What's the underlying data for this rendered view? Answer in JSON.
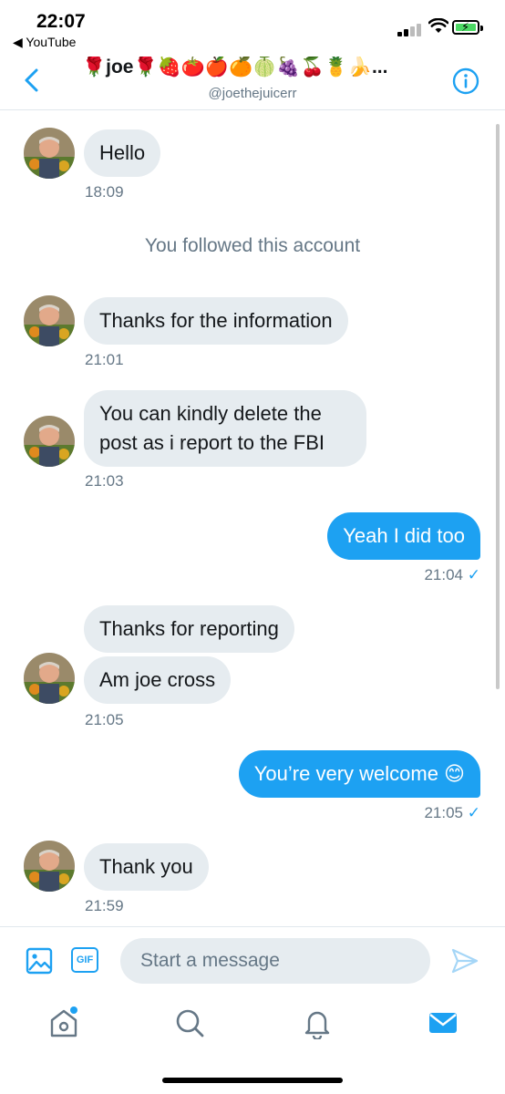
{
  "status_bar": {
    "time": "22:07",
    "back_app": "◀ YouTube"
  },
  "header": {
    "title": "🌹joe🌹🍓🍅🍎🍊🍈🍇🍒🍍🍌...",
    "handle": "@joethejuicerr"
  },
  "conversation": {
    "system_note": "You followed this account",
    "messages": [
      {
        "text": "Hello",
        "time": "18:09"
      },
      {
        "text": "Thanks for the information",
        "time": "21:01"
      },
      {
        "text": "You can kindly delete the post as i report to the FBI",
        "time": "21:03"
      },
      {
        "text": "Yeah I did too",
        "time": "21:04",
        "check": "✓"
      },
      {
        "text": "Thanks for reporting"
      },
      {
        "text": "Am joe cross",
        "time": "21:05"
      },
      {
        "text": "You’re very welcome 😊",
        "time": "21:05",
        "check": "✓"
      },
      {
        "text": "Thank you",
        "time": "21:59"
      }
    ]
  },
  "composer": {
    "placeholder": "Start a message",
    "gif_label": "GIF"
  },
  "colors": {
    "accent": "#1da1f2",
    "bubble_in": "#e6ecf0",
    "muted": "#657786"
  },
  "icons": [
    "back-arrow-icon",
    "info-icon",
    "image-icon",
    "gif-icon",
    "send-icon",
    "home-icon",
    "search-icon",
    "bell-icon",
    "mail-icon"
  ]
}
